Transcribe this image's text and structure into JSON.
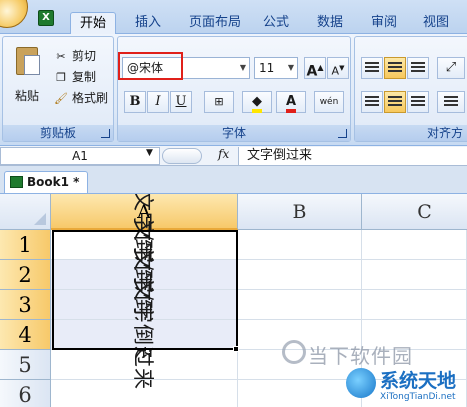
{
  "ribbon": {
    "tabs": [
      "开始",
      "插入",
      "页面布局",
      "公式",
      "数据",
      "审阅",
      "视图"
    ],
    "active_tab": "开始",
    "clipboard": {
      "paste_label": "粘贴",
      "cut_label": "剪切",
      "copy_label": "复制",
      "format_painter_label": "格式刷",
      "group_label": "剪贴板"
    },
    "font": {
      "font_name": "@宋体",
      "font_size": "11",
      "bold": "B",
      "italic": "I",
      "underline": "U",
      "font_color_letter": "A",
      "phonetic_letter": "wén",
      "grow_font": "A",
      "shrink_font": "A",
      "group_label": "字体"
    },
    "alignment": {
      "group_label": "对齐方"
    }
  },
  "formula_bar": {
    "name_box": "A1",
    "fx": "fx",
    "formula": "文字倒过来"
  },
  "workbook": {
    "tab_label": "Book1 *"
  },
  "grid": {
    "columns": [
      "A",
      "B",
      "C"
    ],
    "rows": [
      "1",
      "2",
      "3",
      "4",
      "5",
      "6"
    ],
    "cells_a": [
      "文字倒过来",
      "文字倒过来",
      "文字倒过来",
      "文字倒过来"
    ]
  },
  "watermark": {
    "text1": "当下软件园",
    "text2": "系统天地",
    "text2_sub": "XiTongTianDi.net"
  },
  "colors": {
    "selected_header": "#f7c96a",
    "highlight_box": "#e0201a",
    "ribbon_blue": "#dce8f7"
  }
}
